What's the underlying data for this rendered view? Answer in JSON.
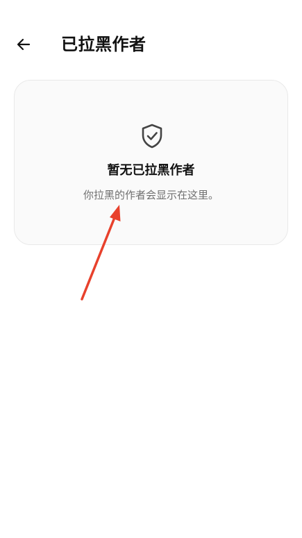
{
  "header": {
    "title": "已拉黑作者",
    "back_icon": "arrow-left-icon"
  },
  "empty_state": {
    "icon": "shield-check-icon",
    "title": "暂无已拉黑作者",
    "description": "你拉黑的作者会显示在这里。"
  },
  "colors": {
    "background": "#ffffff",
    "card_background": "#fafafa",
    "card_border": "#e9e9e9",
    "title_text": "#111111",
    "secondary_text": "#6f6f6f",
    "icon": "#444444",
    "annotation_arrow": "#e8412c"
  }
}
